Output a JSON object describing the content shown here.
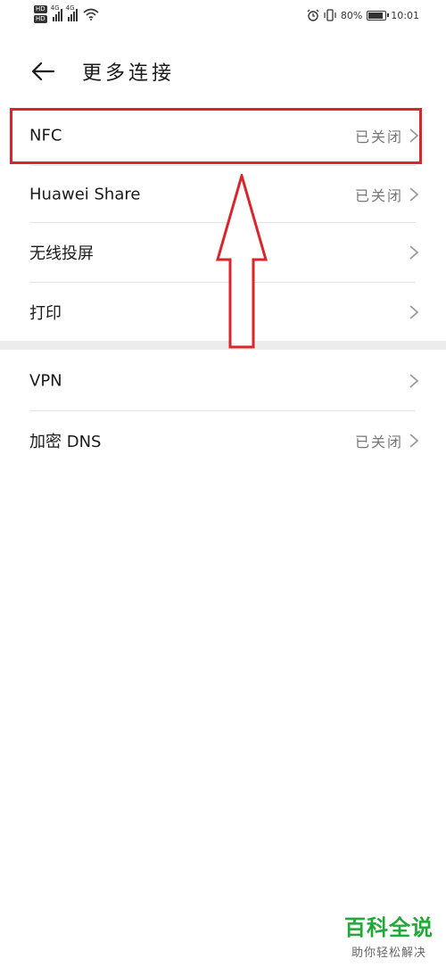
{
  "status_bar": {
    "hd1": "HD",
    "hd2": "HD",
    "net1": "4G",
    "net2": "4G",
    "battery_percent": "80%",
    "battery_level": 0.8,
    "time": "10:01"
  },
  "header": {
    "title": "更多连接"
  },
  "items": [
    {
      "label": "NFC",
      "value": "已关闭"
    },
    {
      "label": "Huawei Share",
      "value": "已关闭"
    },
    {
      "label": "无线投屏",
      "value": ""
    },
    {
      "label": "打印",
      "value": ""
    },
    {
      "label": "VPN",
      "value": ""
    },
    {
      "label": "加密 DNS",
      "value": "已关闭"
    }
  ],
  "annotation": {
    "highlight_color": "#d9262c",
    "highlighted_item": "NFC"
  },
  "watermark": {
    "title": "百科全说",
    "subtitle": "助你轻松解决",
    "color": "#21a838"
  }
}
